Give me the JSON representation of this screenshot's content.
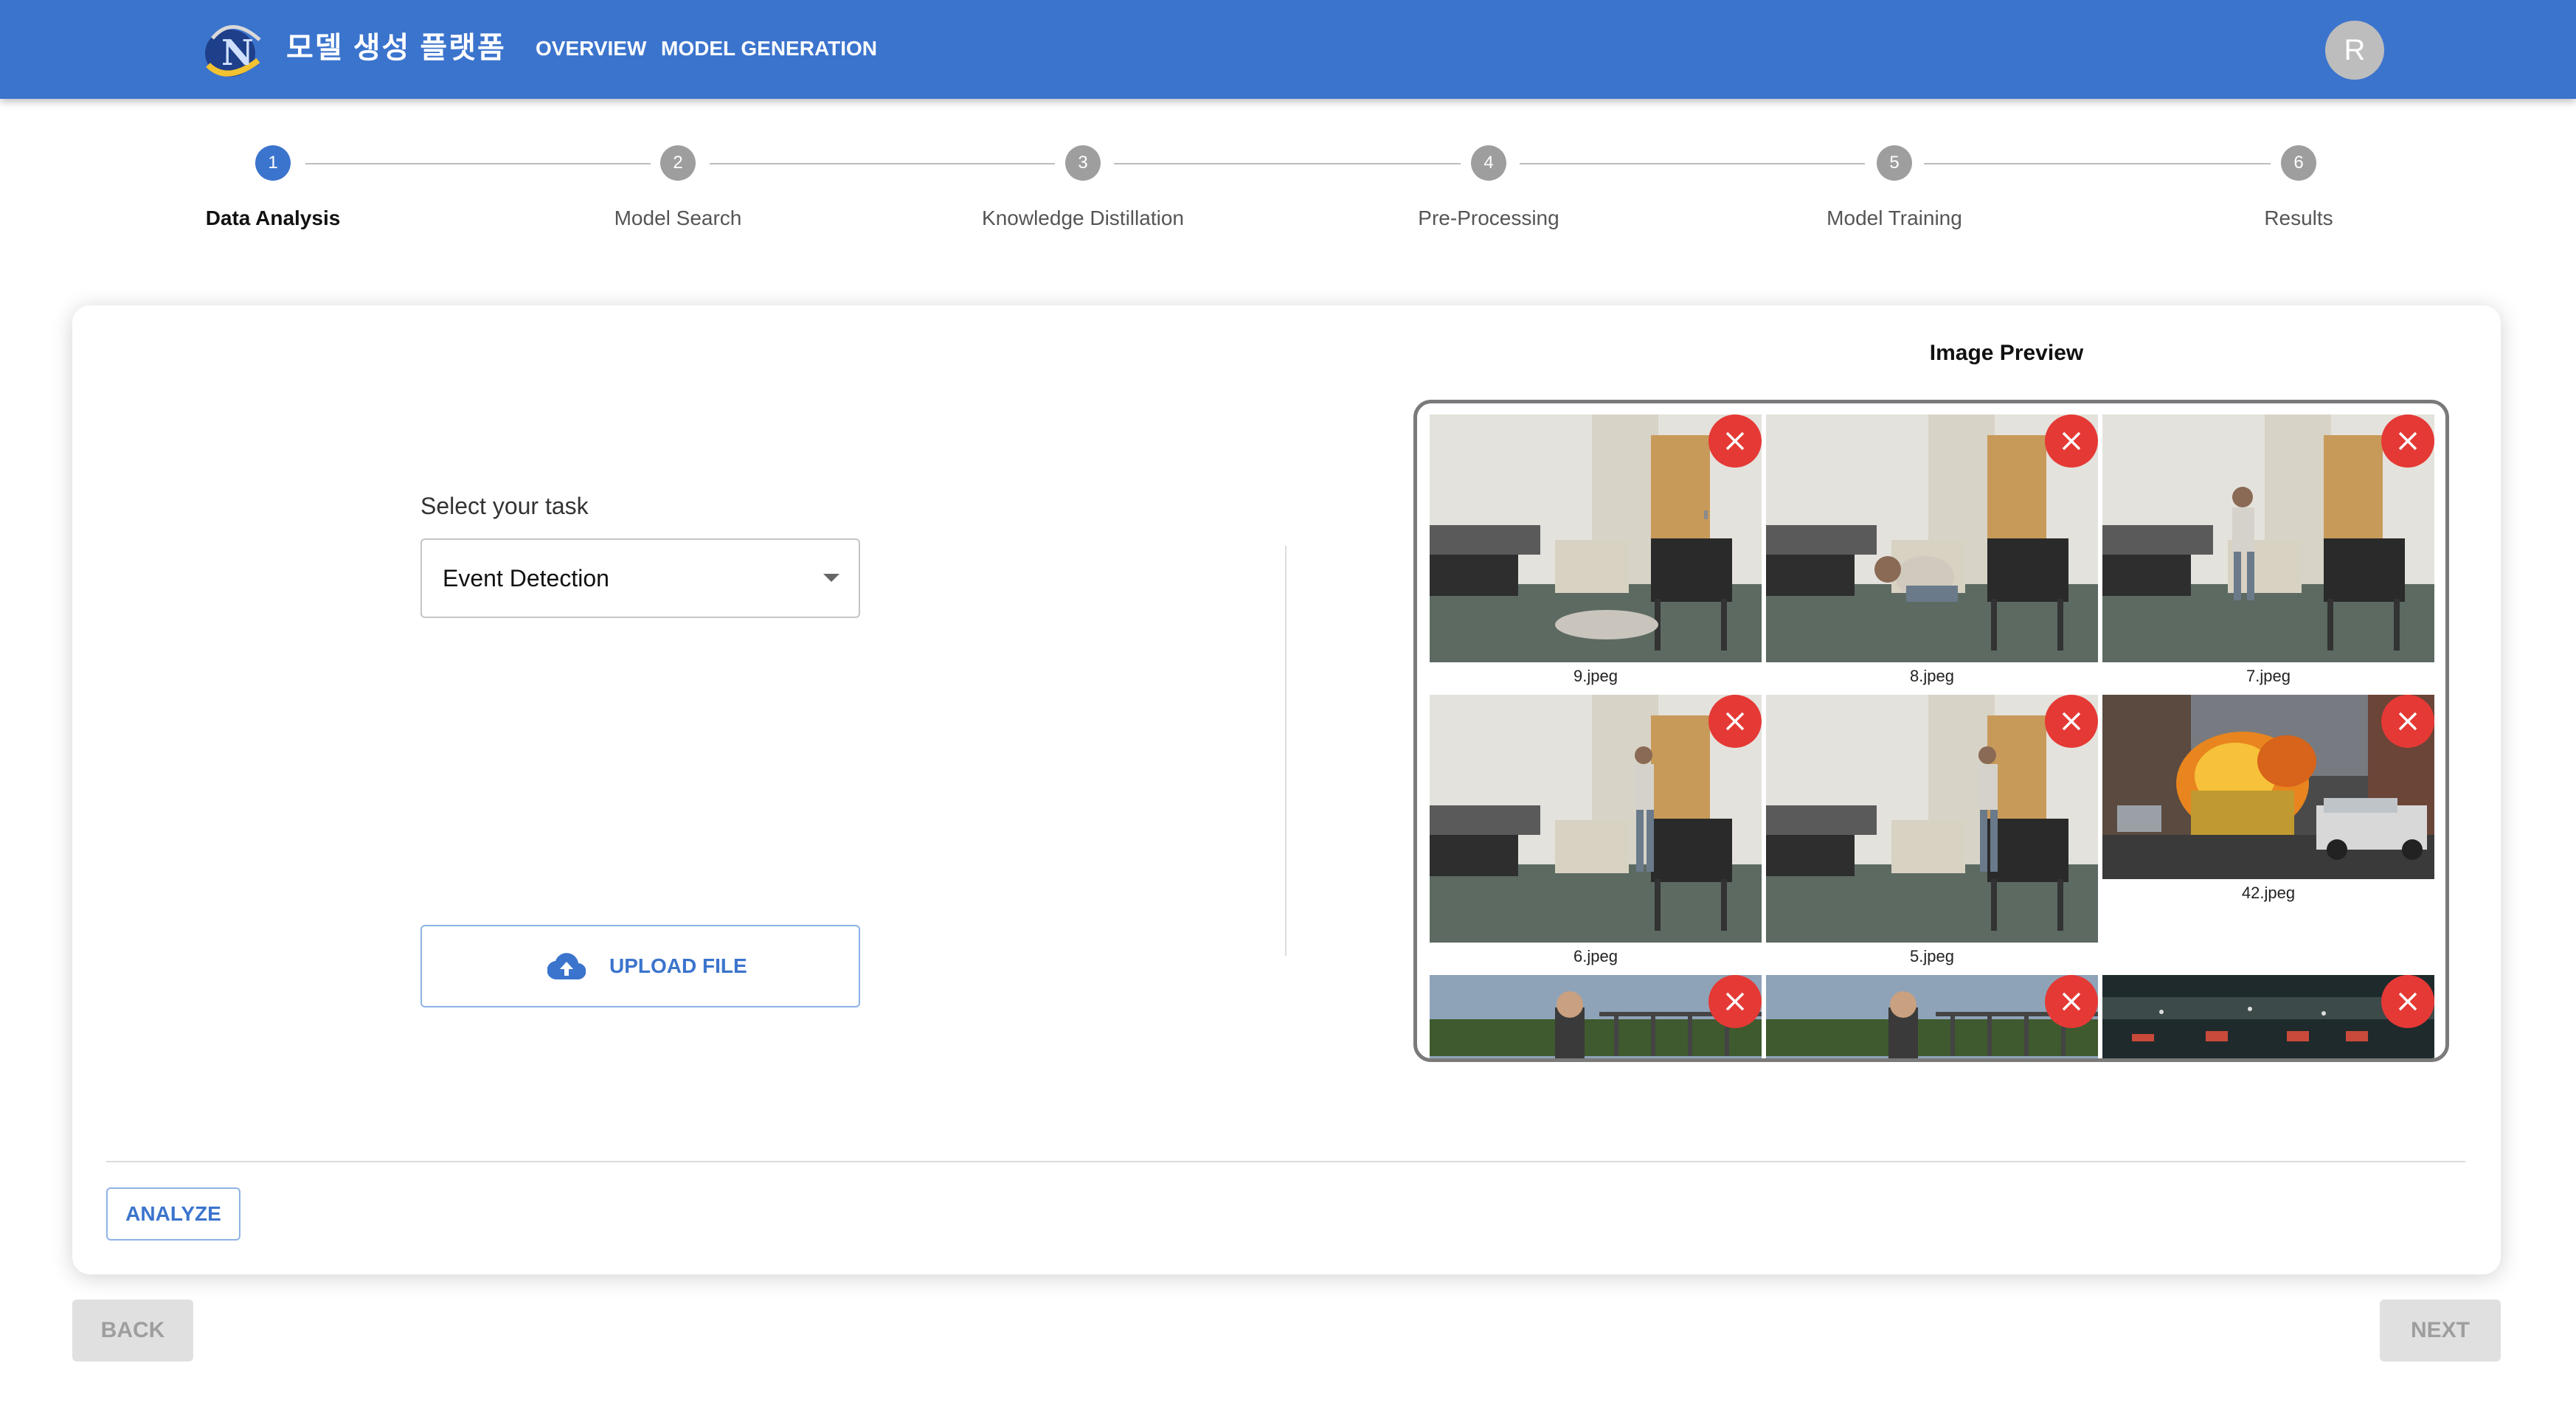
{
  "app": {
    "title": "모델 생성 플랫폼",
    "nav": [
      "OVERVIEW",
      "MODEL GENERATION"
    ],
    "user_initial": "R",
    "colors": {
      "primary": "#3b74cd",
      "danger": "#e53935",
      "inactive_step": "#9e9e9e"
    }
  },
  "stepper": {
    "active_step": 1,
    "steps": [
      {
        "number": "1",
        "label": "Data Analysis"
      },
      {
        "number": "2",
        "label": "Model Search"
      },
      {
        "number": "3",
        "label": "Knowledge Distillation"
      },
      {
        "number": "4",
        "label": "Pre-Processing"
      },
      {
        "number": "5",
        "label": "Model Training"
      },
      {
        "number": "6",
        "label": "Results"
      }
    ]
  },
  "task": {
    "label": "Select your task",
    "selected": "Event Detection",
    "upload_label": "UPLOAD FILE",
    "upload_icon": "cloud-upload-icon"
  },
  "preview": {
    "title": "Image Preview",
    "delete_icon": "close-icon",
    "images": [
      {
        "name": "9.jpeg"
      },
      {
        "name": "8.jpeg"
      },
      {
        "name": "7.jpeg"
      },
      {
        "name": "6.jpeg"
      },
      {
        "name": "5.jpeg"
      },
      {
        "name": "42.jpeg"
      },
      {
        "name": ""
      },
      {
        "name": ""
      },
      {
        "name": ""
      }
    ]
  },
  "actions": {
    "analyze": "ANALYZE",
    "back": "BACK",
    "next": "NEXT"
  }
}
